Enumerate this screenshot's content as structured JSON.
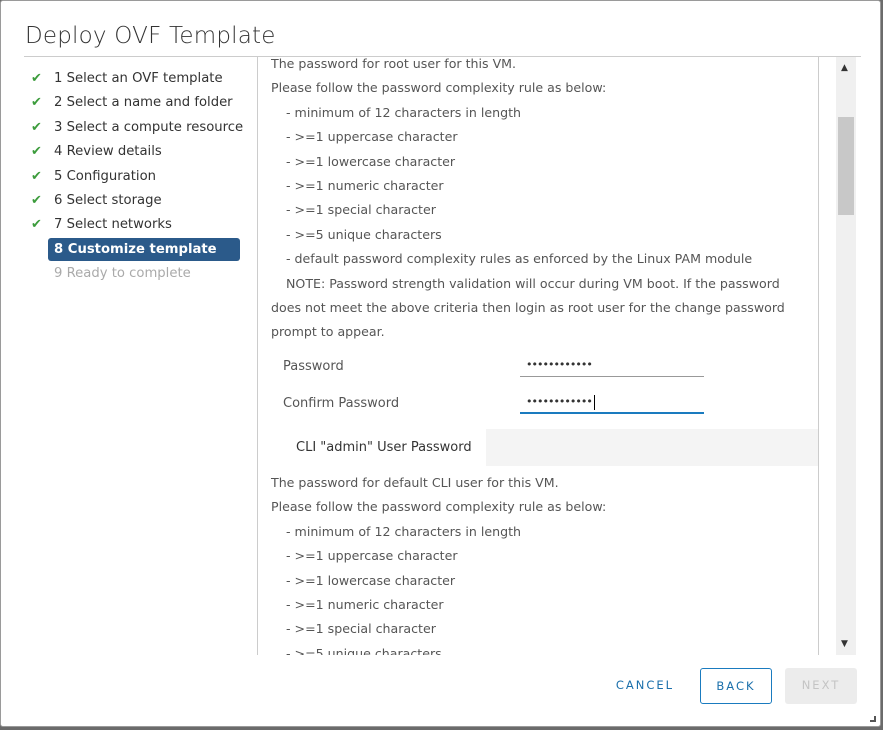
{
  "title": "Deploy OVF Template",
  "steps": [
    {
      "label": "1 Select an OVF template",
      "state": "done"
    },
    {
      "label": "2 Select a name and folder",
      "state": "done"
    },
    {
      "label": "3 Select a compute resource",
      "state": "done"
    },
    {
      "label": "4 Review details",
      "state": "done"
    },
    {
      "label": "5 Configuration",
      "state": "done"
    },
    {
      "label": "6 Select storage",
      "state": "done"
    },
    {
      "label": "7 Select networks",
      "state": "done"
    },
    {
      "label": "8 Customize template",
      "state": "active"
    },
    {
      "label": "9 Ready to complete",
      "state": "disabled"
    }
  ],
  "root_text": [
    "The password for root user for this VM.",
    "Please follow the password complexity rule as below:",
    "- minimum of 12 characters in length",
    "- >=1 uppercase character",
    "- >=1 lowercase character",
    "- >=1 numeric character",
    "- >=1 special character",
    "- >=5 unique characters",
    "- default password complexity rules as enforced by the Linux PAM module",
    "NOTE: Password strength validation will occur during VM boot.  If the password",
    "does not meet the above criteria then login as root user for the change password",
    "prompt to appear."
  ],
  "password_label": "Password",
  "password_value": "••••••••••••",
  "confirm_label": "Confirm Password",
  "confirm_value": "••••••••••••",
  "cli_section": "CLI \"admin\" User Password",
  "cli_text": [
    "The password for default CLI user for this VM.",
    "Please follow the password complexity rule as below:",
    "- minimum of 12 characters in length",
    "- >=1 uppercase character",
    "- >=1 lowercase character",
    "- >=1 numeric character",
    "- >=1 special character",
    "- >=5 unique characters"
  ],
  "buttons": {
    "cancel": "CANCEL",
    "back": "BACK",
    "next": "NEXT"
  },
  "colors": {
    "accent": "#1a7bbf",
    "active_step": "#2b5a8a",
    "check": "#3c9c3c"
  }
}
